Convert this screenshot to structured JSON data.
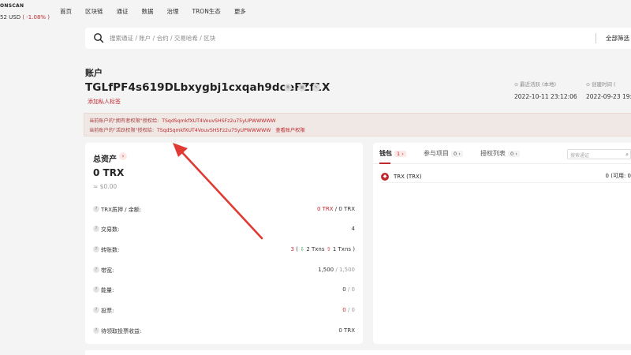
{
  "header": {
    "brand": "ONSCAN",
    "price": "52 USD",
    "price_change": "( -1.08% )",
    "nav": [
      "首页",
      "区块链",
      "通证",
      "数据",
      "治理",
      "TRON生态",
      "更多"
    ]
  },
  "search": {
    "placeholder": "搜索通证 / 账户 / 合约 / 交易哈希 / 区块",
    "filter_label": "全部筛选"
  },
  "account": {
    "title": "账户",
    "address": "TGLfPF4s619DLbxygbj1cxqah9doeFZf1X",
    "add_tag": "添加私人标签",
    "last_active_label": "最近活跃 (本地)",
    "last_active": "2022-10-11 23:12:06",
    "created_label": "创建时间 (",
    "created": "2022-09-23 19:1",
    "owner_perm_text": "当前账户的\"拥有者权限\"授权给:",
    "owner_perm_addr": "TSqdSqmkfXUT4VouvSHSFz2u75yUPWWWWW",
    "active_perm_text": "当前账户的\"活跃权限\"授权给:",
    "active_perm_addr": "TSqdSqmkfXUT4VouvSHSFz2u75yUPWWWWW",
    "view_perm": "查看账户权限"
  },
  "assets": {
    "title": "总资产",
    "total": "0 TRX",
    "total_usd": "≈ $0.00",
    "rows": {
      "stake_label": "TRX质押 / 余额:",
      "stake_red": "0 TRX",
      "stake_rest": "/ 0 TRX",
      "txn_label": "交易数:",
      "txn_val": "4",
      "transfer_label": "转账数:",
      "transfer_val": "3",
      "transfer_in": "2 Txns",
      "transfer_out": "1 Txns",
      "bw_label": "带宽:",
      "bw_a": "1,500",
      "bw_b": "/ 1,500",
      "energy_label": "能量:",
      "energy_a": "0",
      "energy_b": "/ 0",
      "vote_label": "投票:",
      "vote_a": "0",
      "vote_b": "/ 0",
      "reward_label": "待领取投票收益:",
      "reward_val": "0 TRX"
    }
  },
  "wallet": {
    "tabs": [
      {
        "label": "钱包",
        "count": "1"
      },
      {
        "label": "参与项目",
        "count": "0"
      },
      {
        "label": "授权列表",
        "count": "0"
      }
    ],
    "search_placeholder": "搜索通证",
    "token_name": "TRX (TRX)",
    "token_balance": "0 (可用: 0"
  }
}
